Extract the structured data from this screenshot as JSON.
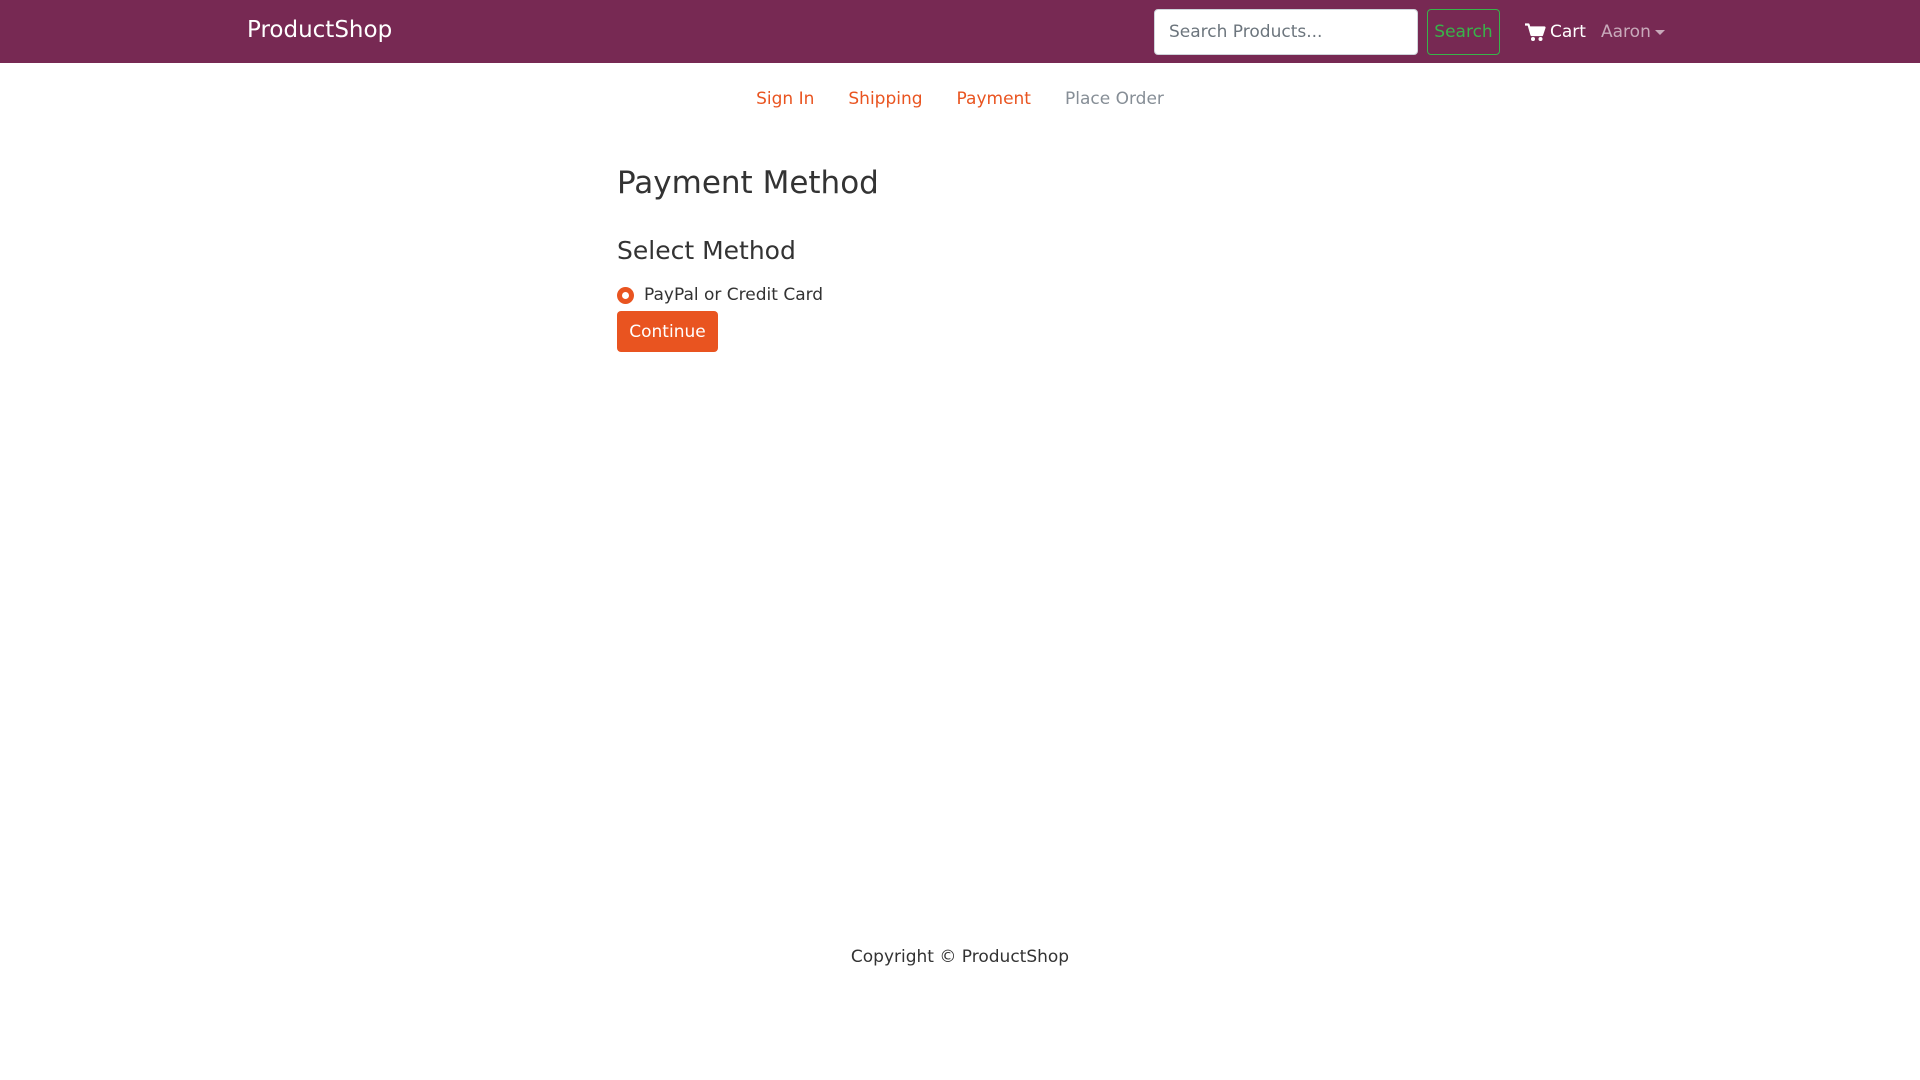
{
  "header": {
    "brand": "ProductShop",
    "search": {
      "placeholder": "Search Products...",
      "value": ""
    },
    "search_button": "Search",
    "cart_label": "Cart",
    "cart_icon": "shopping-cart-icon",
    "user_name": "Aaron",
    "user_menu_icon": "caret-down-icon"
  },
  "checkout_steps": [
    {
      "label": "Sign In",
      "state": "enabled"
    },
    {
      "label": "Shipping",
      "state": "enabled"
    },
    {
      "label": "Payment",
      "state": "enabled"
    },
    {
      "label": "Place Order",
      "state": "disabled"
    }
  ],
  "main": {
    "title": "Payment Method",
    "section_title": "Select Method",
    "payment_options": [
      {
        "label": "PayPal or Credit Card",
        "selected": true
      }
    ],
    "continue_button": "Continue"
  },
  "footer": {
    "text": "Copyright © ProductShop"
  },
  "colors": {
    "navbar": "#772953",
    "primary": "#e95420",
    "success": "#38b44a",
    "disabled_text": "#868e96",
    "body_text": "#333333"
  }
}
